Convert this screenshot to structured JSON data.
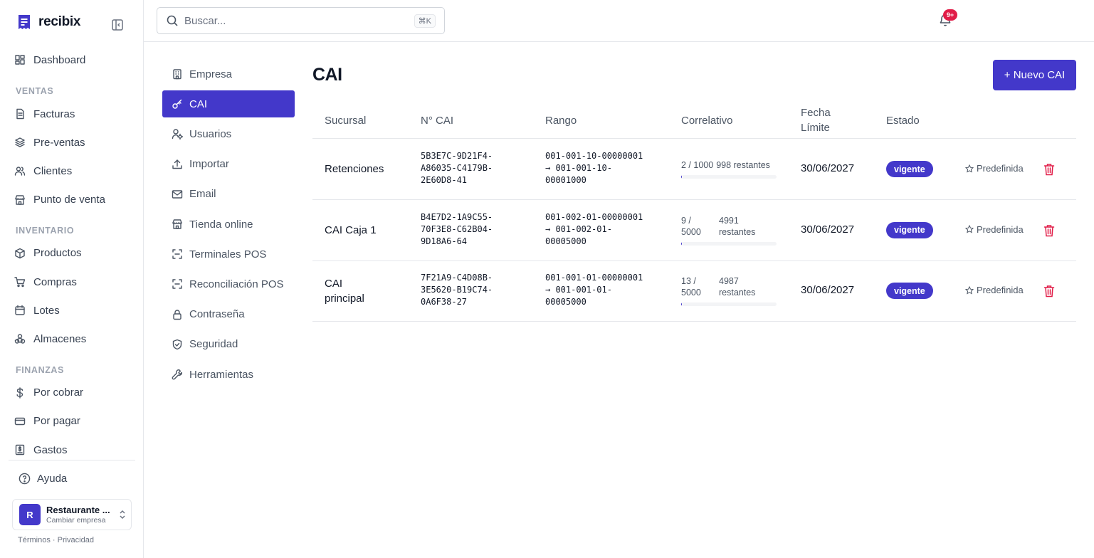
{
  "brand": {
    "name": "recibix",
    "accent": "#4338ca"
  },
  "sidebar": {
    "items_top": [
      {
        "label": "Dashboard",
        "icon": "dashboard-icon"
      }
    ],
    "sections": [
      {
        "title": "VENTAS",
        "items": [
          {
            "label": "Facturas",
            "icon": "file-icon"
          },
          {
            "label": "Pre-ventas",
            "icon": "layers-icon"
          },
          {
            "label": "Clientes",
            "icon": "users-icon"
          },
          {
            "label": "Punto de venta",
            "icon": "store-icon"
          }
        ]
      },
      {
        "title": "INVENTARIO",
        "items": [
          {
            "label": "Productos",
            "icon": "package-icon"
          },
          {
            "label": "Compras",
            "icon": "cart-icon"
          },
          {
            "label": "Lotes",
            "icon": "calendar-icon"
          },
          {
            "label": "Almacenes",
            "icon": "boxes-icon"
          }
        ]
      },
      {
        "title": "FINANZAS",
        "items": [
          {
            "label": "Por cobrar",
            "icon": "dollar-icon"
          },
          {
            "label": "Por pagar",
            "icon": "credit-card-icon"
          },
          {
            "label": "Gastos",
            "icon": "receipt-icon"
          }
        ]
      }
    ],
    "help": "Ayuda",
    "company": {
      "initial": "R",
      "name": "Restaurante ...",
      "sub": "Cambiar empresa"
    },
    "footer": "Términos · Privacidad"
  },
  "topbar": {
    "search_placeholder": "Buscar...",
    "search_shortcut": "⌘K",
    "notifications_badge": "9+"
  },
  "settings_nav": [
    {
      "label": "Empresa",
      "icon": "building-icon",
      "active": false
    },
    {
      "label": "CAI",
      "icon": "key-icon",
      "active": true
    },
    {
      "label": "Usuarios",
      "icon": "user-cog-icon",
      "active": false
    },
    {
      "label": "Importar",
      "icon": "upload-icon",
      "active": false
    },
    {
      "label": "Email",
      "icon": "mail-icon",
      "active": false
    },
    {
      "label": "Tienda online",
      "icon": "store-icon",
      "active": false
    },
    {
      "label": "Terminales POS",
      "icon": "scan-icon",
      "active": false
    },
    {
      "label": "Reconciliación POS",
      "icon": "scan-icon",
      "active": false
    },
    {
      "label": "Contraseña",
      "icon": "lock-icon",
      "active": false
    },
    {
      "label": "Seguridad",
      "icon": "shield-icon",
      "active": false
    },
    {
      "label": "Herramientas",
      "icon": "wrench-icon",
      "active": false
    }
  ],
  "page": {
    "title": "CAI",
    "new_button": "+ Nuevo CAI"
  },
  "table": {
    "headers": {
      "sucursal": "Sucursal",
      "cai": "N° CAI",
      "rango": "Rango",
      "correlativo": "Correlativo",
      "fecha_1": "Fecha",
      "fecha_2": "Límite",
      "estado": "Estado"
    },
    "rows": [
      {
        "sucursal": [
          "Retenciones"
        ],
        "cai": [
          "5B3E7C-9D21F4-",
          "A86035-C4179B-",
          "2E60D8-41"
        ],
        "rango": [
          "001-001-10-00000001",
          "→ 001-001-10-",
          "00001000"
        ],
        "corr_used": [
          "2 / 1000"
        ],
        "corr_left": [
          "998 restantes"
        ],
        "progress": 0.002,
        "fecha": "30/06/2027",
        "estado": "vigente",
        "predefinida": "Predefinida"
      },
      {
        "sucursal": [
          "CAI Caja 1"
        ],
        "cai": [
          "B4E7D2-1A9C55-",
          "70F3E8-C62B04-",
          "9D18A6-64"
        ],
        "rango": [
          "001-002-01-00000001",
          "→ 001-002-01-",
          "00005000"
        ],
        "corr_used": [
          "9 /",
          "5000"
        ],
        "corr_left": [
          "4991",
          "restantes"
        ],
        "progress": 0.0018,
        "fecha": "30/06/2027",
        "estado": "vigente",
        "predefinida": "Predefinida"
      },
      {
        "sucursal": [
          "CAI",
          "principal"
        ],
        "cai": [
          "7F21A9-C4D08B-",
          "3E5620-B19C74-",
          "0A6F38-27"
        ],
        "rango": [
          "001-001-01-00000001",
          "→ 001-001-01-",
          "00005000"
        ],
        "corr_used": [
          "13 /",
          "5000"
        ],
        "corr_left": [
          "4987",
          "restantes"
        ],
        "progress": 0.0026,
        "fecha": "30/06/2027",
        "estado": "vigente",
        "predefinida": "Predefinida"
      }
    ]
  }
}
